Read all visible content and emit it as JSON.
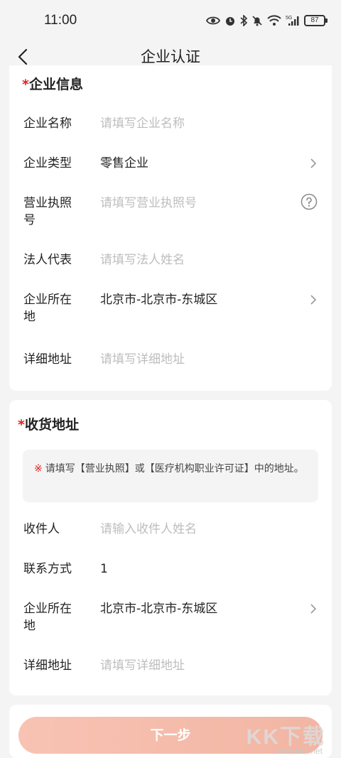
{
  "status_bar": {
    "time": "11:00",
    "network": "5G",
    "battery": "87"
  },
  "nav": {
    "title": "企业认证"
  },
  "company_section": {
    "required_mark": "*",
    "title": "企业信息",
    "fields": {
      "name": {
        "label": "企业名称",
        "placeholder": "请填写企业名称"
      },
      "type": {
        "label": "企业类型",
        "value": "零售企业"
      },
      "license": {
        "label": "营业执照号",
        "placeholder": "请填写营业执照号"
      },
      "legal_rep": {
        "label": "法人代表",
        "placeholder": "请填写法人姓名"
      },
      "location": {
        "label": "企业所在地",
        "value": "北京市-北京市-东城区"
      },
      "address": {
        "label": "详细地址",
        "placeholder": "请填写详细地址"
      }
    }
  },
  "shipping_section": {
    "required_mark": "*",
    "title": "收货地址",
    "notice_mark": "※",
    "notice": "请填写【营业执照】或【医疗机构职业许可证】中的地址。",
    "fields": {
      "recipient": {
        "label": "收件人",
        "placeholder": "请输入收件人姓名"
      },
      "contact": {
        "label": "联系方式",
        "value": "1"
      },
      "location": {
        "label": "企业所在地",
        "value": "北京市-北京市-东城区"
      },
      "address": {
        "label": "详细地址",
        "placeholder": "请填写详细地址"
      }
    }
  },
  "footer": {
    "next_label": "下一步"
  },
  "watermark": {
    "logo": "KK下载",
    "url": "www.kkx.net"
  }
}
